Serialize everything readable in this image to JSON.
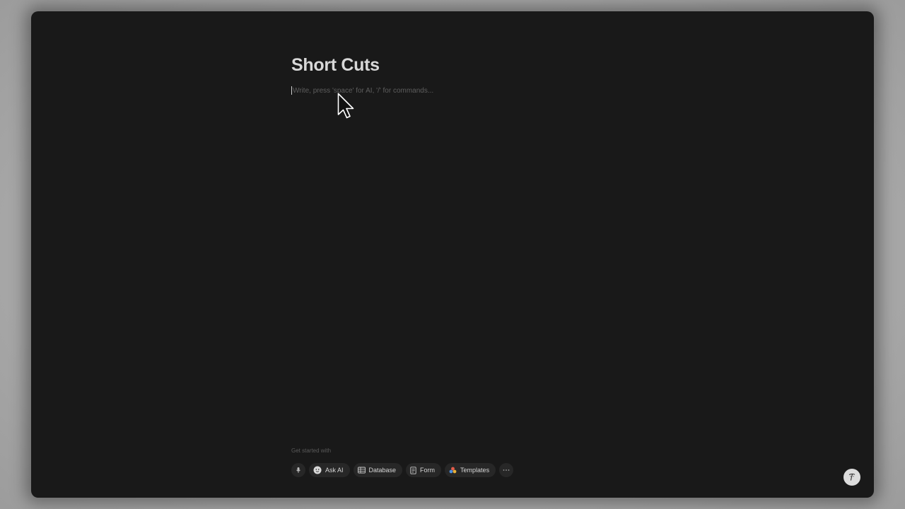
{
  "page": {
    "title": "Short Cuts",
    "editor_placeholder": "Write, press 'space' for AI, '/' for commands..."
  },
  "get_started": {
    "label": "Get started with",
    "chips": [
      {
        "icon": "microphone-icon",
        "label": ""
      },
      {
        "icon": "ai-face-icon",
        "label": "Ask AI"
      },
      {
        "icon": "table-icon",
        "label": "Database"
      },
      {
        "icon": "form-icon",
        "label": "Form"
      },
      {
        "icon": "templates-icon",
        "label": "Templates"
      },
      {
        "icon": "more-icon",
        "label": ""
      }
    ]
  },
  "help": {
    "icon": "help-face-icon"
  },
  "colors": {
    "background": "#191919",
    "title": "#d8d8d8",
    "chip_bg": "#272727",
    "placeholder": "#5e5e5e"
  }
}
